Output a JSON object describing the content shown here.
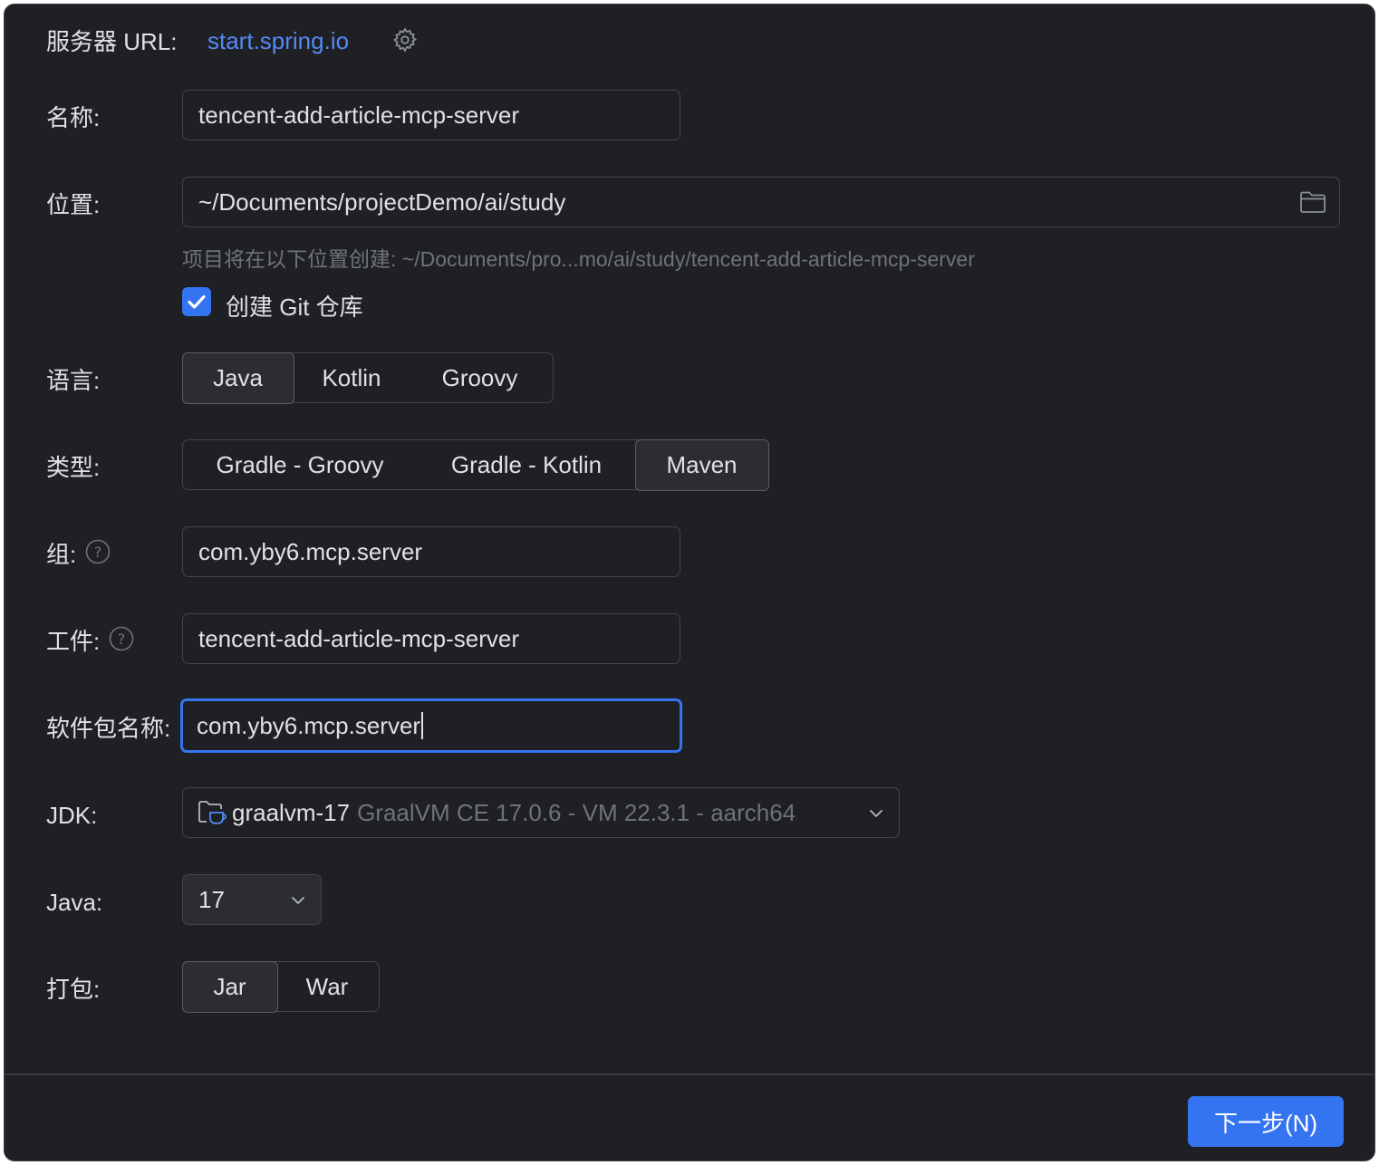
{
  "server": {
    "label": "服务器 URL:",
    "url": "start.spring.io"
  },
  "name": {
    "label": "名称:",
    "value": "tencent-add-article-mcp-server"
  },
  "location": {
    "label": "位置:",
    "value": "~/Documents/projectDemo/ai/study",
    "hint": "项目将在以下位置创建: ~/Documents/pro...mo/ai/study/tencent-add-article-mcp-server"
  },
  "git": {
    "label": "创建 Git 仓库",
    "checked": true
  },
  "language": {
    "label": "语言:",
    "options": [
      "Java",
      "Kotlin",
      "Groovy"
    ],
    "selected": "Java"
  },
  "type": {
    "label": "类型:",
    "options": [
      "Gradle - Groovy",
      "Gradle - Kotlin",
      "Maven"
    ],
    "selected": "Maven"
  },
  "group": {
    "label": "组:",
    "value": "com.yby6.mcp.server"
  },
  "artifact": {
    "label": "工件:",
    "value": "tencent-add-article-mcp-server"
  },
  "package_name": {
    "label": "软件包名称:",
    "value": "com.yby6.mcp.server"
  },
  "jdk": {
    "label": "JDK:",
    "name": "graalvm-17",
    "detail": "GraalVM CE 17.0.6 - VM 22.3.1 - aarch64"
  },
  "java_version": {
    "label": "Java:",
    "value": "17"
  },
  "packaging": {
    "label": "打包:",
    "options": [
      "Jar",
      "War"
    ],
    "selected": "Jar"
  },
  "footer": {
    "next_label": "下一步(N)"
  },
  "colors": {
    "background": "#1f2023",
    "accent": "#3574f0",
    "link": "#548af7",
    "text": "#dfe1e5",
    "muted": "#6f737a"
  }
}
